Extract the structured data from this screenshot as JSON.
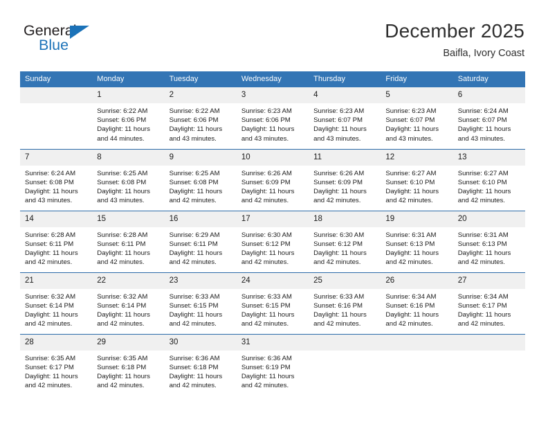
{
  "brand": {
    "name_part1": "General",
    "name_part2": "Blue",
    "flag_icon": "triangle-flag-icon",
    "accent_color": "#1b72b8"
  },
  "header": {
    "title": "December 2025",
    "subtitle": "Baifla, Ivory Coast"
  },
  "calendar": {
    "header_bg": "#3375b5",
    "daynum_bg": "#f0f0f0",
    "row_divider": "#2a6aa8",
    "weekday_headers": [
      "Sunday",
      "Monday",
      "Tuesday",
      "Wednesday",
      "Thursday",
      "Friday",
      "Saturday"
    ],
    "weeks": [
      [
        {
          "day": "",
          "sunrise": "",
          "sunset": "",
          "daylight1": "",
          "daylight2": ""
        },
        {
          "day": "1",
          "sunrise": "Sunrise: 6:22 AM",
          "sunset": "Sunset: 6:06 PM",
          "daylight1": "Daylight: 11 hours",
          "daylight2": "and 44 minutes."
        },
        {
          "day": "2",
          "sunrise": "Sunrise: 6:22 AM",
          "sunset": "Sunset: 6:06 PM",
          "daylight1": "Daylight: 11 hours",
          "daylight2": "and 43 minutes."
        },
        {
          "day": "3",
          "sunrise": "Sunrise: 6:23 AM",
          "sunset": "Sunset: 6:06 PM",
          "daylight1": "Daylight: 11 hours",
          "daylight2": "and 43 minutes."
        },
        {
          "day": "4",
          "sunrise": "Sunrise: 6:23 AM",
          "sunset": "Sunset: 6:07 PM",
          "daylight1": "Daylight: 11 hours",
          "daylight2": "and 43 minutes."
        },
        {
          "day": "5",
          "sunrise": "Sunrise: 6:23 AM",
          "sunset": "Sunset: 6:07 PM",
          "daylight1": "Daylight: 11 hours",
          "daylight2": "and 43 minutes."
        },
        {
          "day": "6",
          "sunrise": "Sunrise: 6:24 AM",
          "sunset": "Sunset: 6:07 PM",
          "daylight1": "Daylight: 11 hours",
          "daylight2": "and 43 minutes."
        }
      ],
      [
        {
          "day": "7",
          "sunrise": "Sunrise: 6:24 AM",
          "sunset": "Sunset: 6:08 PM",
          "daylight1": "Daylight: 11 hours",
          "daylight2": "and 43 minutes."
        },
        {
          "day": "8",
          "sunrise": "Sunrise: 6:25 AM",
          "sunset": "Sunset: 6:08 PM",
          "daylight1": "Daylight: 11 hours",
          "daylight2": "and 43 minutes."
        },
        {
          "day": "9",
          "sunrise": "Sunrise: 6:25 AM",
          "sunset": "Sunset: 6:08 PM",
          "daylight1": "Daylight: 11 hours",
          "daylight2": "and 42 minutes."
        },
        {
          "day": "10",
          "sunrise": "Sunrise: 6:26 AM",
          "sunset": "Sunset: 6:09 PM",
          "daylight1": "Daylight: 11 hours",
          "daylight2": "and 42 minutes."
        },
        {
          "day": "11",
          "sunrise": "Sunrise: 6:26 AM",
          "sunset": "Sunset: 6:09 PM",
          "daylight1": "Daylight: 11 hours",
          "daylight2": "and 42 minutes."
        },
        {
          "day": "12",
          "sunrise": "Sunrise: 6:27 AM",
          "sunset": "Sunset: 6:10 PM",
          "daylight1": "Daylight: 11 hours",
          "daylight2": "and 42 minutes."
        },
        {
          "day": "13",
          "sunrise": "Sunrise: 6:27 AM",
          "sunset": "Sunset: 6:10 PM",
          "daylight1": "Daylight: 11 hours",
          "daylight2": "and 42 minutes."
        }
      ],
      [
        {
          "day": "14",
          "sunrise": "Sunrise: 6:28 AM",
          "sunset": "Sunset: 6:11 PM",
          "daylight1": "Daylight: 11 hours",
          "daylight2": "and 42 minutes."
        },
        {
          "day": "15",
          "sunrise": "Sunrise: 6:28 AM",
          "sunset": "Sunset: 6:11 PM",
          "daylight1": "Daylight: 11 hours",
          "daylight2": "and 42 minutes."
        },
        {
          "day": "16",
          "sunrise": "Sunrise: 6:29 AM",
          "sunset": "Sunset: 6:11 PM",
          "daylight1": "Daylight: 11 hours",
          "daylight2": "and 42 minutes."
        },
        {
          "day": "17",
          "sunrise": "Sunrise: 6:30 AM",
          "sunset": "Sunset: 6:12 PM",
          "daylight1": "Daylight: 11 hours",
          "daylight2": "and 42 minutes."
        },
        {
          "day": "18",
          "sunrise": "Sunrise: 6:30 AM",
          "sunset": "Sunset: 6:12 PM",
          "daylight1": "Daylight: 11 hours",
          "daylight2": "and 42 minutes."
        },
        {
          "day": "19",
          "sunrise": "Sunrise: 6:31 AM",
          "sunset": "Sunset: 6:13 PM",
          "daylight1": "Daylight: 11 hours",
          "daylight2": "and 42 minutes."
        },
        {
          "day": "20",
          "sunrise": "Sunrise: 6:31 AM",
          "sunset": "Sunset: 6:13 PM",
          "daylight1": "Daylight: 11 hours",
          "daylight2": "and 42 minutes."
        }
      ],
      [
        {
          "day": "21",
          "sunrise": "Sunrise: 6:32 AM",
          "sunset": "Sunset: 6:14 PM",
          "daylight1": "Daylight: 11 hours",
          "daylight2": "and 42 minutes."
        },
        {
          "day": "22",
          "sunrise": "Sunrise: 6:32 AM",
          "sunset": "Sunset: 6:14 PM",
          "daylight1": "Daylight: 11 hours",
          "daylight2": "and 42 minutes."
        },
        {
          "day": "23",
          "sunrise": "Sunrise: 6:33 AM",
          "sunset": "Sunset: 6:15 PM",
          "daylight1": "Daylight: 11 hours",
          "daylight2": "and 42 minutes."
        },
        {
          "day": "24",
          "sunrise": "Sunrise: 6:33 AM",
          "sunset": "Sunset: 6:15 PM",
          "daylight1": "Daylight: 11 hours",
          "daylight2": "and 42 minutes."
        },
        {
          "day": "25",
          "sunrise": "Sunrise: 6:33 AM",
          "sunset": "Sunset: 6:16 PM",
          "daylight1": "Daylight: 11 hours",
          "daylight2": "and 42 minutes."
        },
        {
          "day": "26",
          "sunrise": "Sunrise: 6:34 AM",
          "sunset": "Sunset: 6:16 PM",
          "daylight1": "Daylight: 11 hours",
          "daylight2": "and 42 minutes."
        },
        {
          "day": "27",
          "sunrise": "Sunrise: 6:34 AM",
          "sunset": "Sunset: 6:17 PM",
          "daylight1": "Daylight: 11 hours",
          "daylight2": "and 42 minutes."
        }
      ],
      [
        {
          "day": "28",
          "sunrise": "Sunrise: 6:35 AM",
          "sunset": "Sunset: 6:17 PM",
          "daylight1": "Daylight: 11 hours",
          "daylight2": "and 42 minutes."
        },
        {
          "day": "29",
          "sunrise": "Sunrise: 6:35 AM",
          "sunset": "Sunset: 6:18 PM",
          "daylight1": "Daylight: 11 hours",
          "daylight2": "and 42 minutes."
        },
        {
          "day": "30",
          "sunrise": "Sunrise: 6:36 AM",
          "sunset": "Sunset: 6:18 PM",
          "daylight1": "Daylight: 11 hours",
          "daylight2": "and 42 minutes."
        },
        {
          "day": "31",
          "sunrise": "Sunrise: 6:36 AM",
          "sunset": "Sunset: 6:19 PM",
          "daylight1": "Daylight: 11 hours",
          "daylight2": "and 42 minutes."
        },
        {
          "day": "",
          "sunrise": "",
          "sunset": "",
          "daylight1": "",
          "daylight2": ""
        },
        {
          "day": "",
          "sunrise": "",
          "sunset": "",
          "daylight1": "",
          "daylight2": ""
        },
        {
          "day": "",
          "sunrise": "",
          "sunset": "",
          "daylight1": "",
          "daylight2": ""
        }
      ]
    ]
  }
}
